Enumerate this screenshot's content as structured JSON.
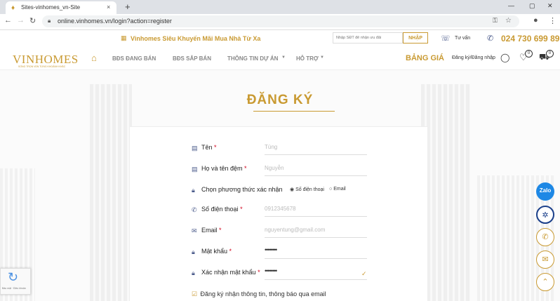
{
  "browser": {
    "tab_title": "Sites-vinhomes_vn-Site",
    "tab_close": "×",
    "new_tab": "+",
    "url": "online.vinhomes.vn/login?action=register",
    "window_controls": [
      "—",
      "▢",
      "✕"
    ]
  },
  "topbar": {
    "promo": "Vinhomes Siêu Khuyến Mãi Mua Nhà Từ Xa",
    "phone_placeholder": "Nhập SĐT để nhận ưu đãi",
    "nhap_label": "NHẬP",
    "tuvan_label": "Tư vấn",
    "hotline": "024 730 699 89"
  },
  "nav": {
    "logo": "VINHOMES",
    "logo_sub": "SỐNG TRỌN VẸN TỪNG KHOẢNH KHẮC",
    "items": [
      "BĐS ĐANG BÁN",
      "BĐS SẮP BÁN",
      "THÔNG TIN DỰ ÁN",
      "HỖ TRỢ"
    ],
    "bang_gia": "BẢNG GIÁ",
    "login": "Đăng ký/Đăng nhập",
    "wishlist_count": "0",
    "cart_count": "0"
  },
  "form": {
    "heading": "ĐĂNG KÝ",
    "fields": {
      "ten": {
        "label": "Tên",
        "value": "Tùng"
      },
      "hodem": {
        "label": "Họ và tên đệm",
        "value": "Nguyễn"
      },
      "phuongthuc": {
        "label": "Chọn phương thức xác nhận",
        "option1": "Số điện thoại",
        "option2": "Email",
        "selected": "Số điện thoại"
      },
      "sdt": {
        "label": "Số điện thoại",
        "value": "0912345678"
      },
      "email": {
        "label": "Email",
        "value": "nguyentung@gmail.com"
      },
      "matkhau": {
        "label": "Mật khẩu",
        "value": "••••••••"
      },
      "xacnhan": {
        "label": "Xác nhận mật khẩu",
        "value": "••••••••"
      }
    },
    "subscribe_label": "Đăng ký nhận thông tin, thông báo qua email",
    "required_mark": "*"
  },
  "floating": {
    "zalo": "Zalo"
  },
  "recaptcha": {
    "label": "Bảo mật · Điều khoản"
  },
  "colors": {
    "brand": "#c99a32",
    "required": "#d0021b",
    "icon": "#4a5a8a"
  }
}
